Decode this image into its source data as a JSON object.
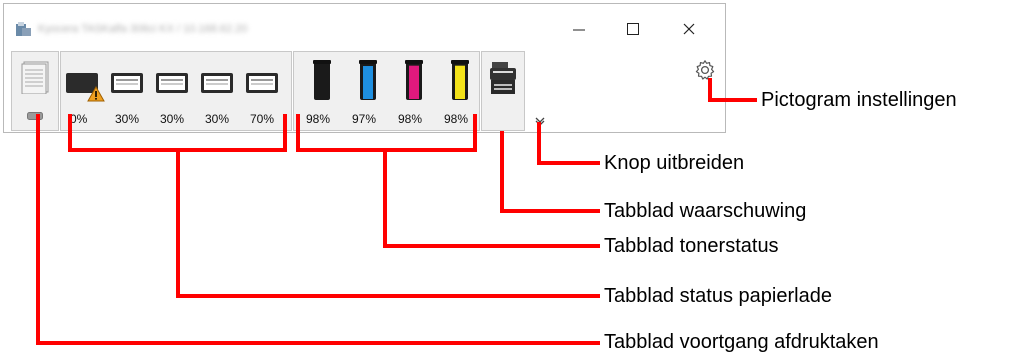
{
  "window": {
    "title": "Kyocera TASKalfa 306ci KX / 10.168.62.20",
    "controls": {
      "minimize_icon": "minimize-icon",
      "maximize_icon": "maximize-icon",
      "close_icon": "close-icon"
    }
  },
  "tabs": {
    "paper_trays": {
      "levels": [
        "0%",
        "30%",
        "30%",
        "30%",
        "70%"
      ],
      "warning_on_tray": 1
    },
    "toner": {
      "levels": [
        "98%",
        "97%",
        "98%",
        "98%"
      ],
      "colors": [
        "#1a1a1a",
        "#1e8fe0",
        "#e0197d",
        "#f3e21a"
      ]
    }
  },
  "callouts": {
    "settings_icon": "Pictogram instellingen",
    "expand_button": "Knop uitbreiden",
    "alert_tab": "Tabblad waarschuwing",
    "toner_tab": "Tabblad tonerstatus",
    "paper_tab": "Tabblad status papierlade",
    "job_tab": "Tabblad voortgang afdruktaken"
  },
  "colors": {
    "callout_line": "#ff0000",
    "warning": "#f0a020"
  }
}
